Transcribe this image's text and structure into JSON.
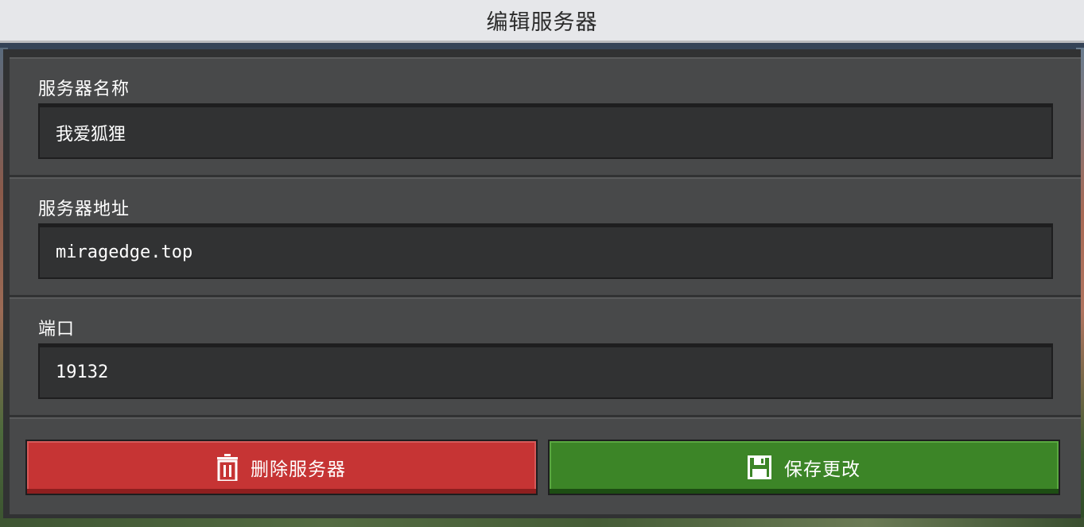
{
  "title": "编辑服务器",
  "fields": [
    {
      "label": "服务器名称",
      "value": "我爱狐狸"
    },
    {
      "label": "服务器地址",
      "value": "miragedge.top"
    },
    {
      "label": "端口",
      "value": "19132"
    }
  ],
  "buttons": {
    "delete_label": "删除服务器",
    "save_label": "保存更改"
  },
  "icons": {
    "delete": "trash-icon",
    "save": "floppy-disk-icon"
  },
  "colors": {
    "delete": "#c63434",
    "save": "#3c8527",
    "panel": "#48494a",
    "field": "#313233",
    "titlebar": "#e6e7ea"
  }
}
